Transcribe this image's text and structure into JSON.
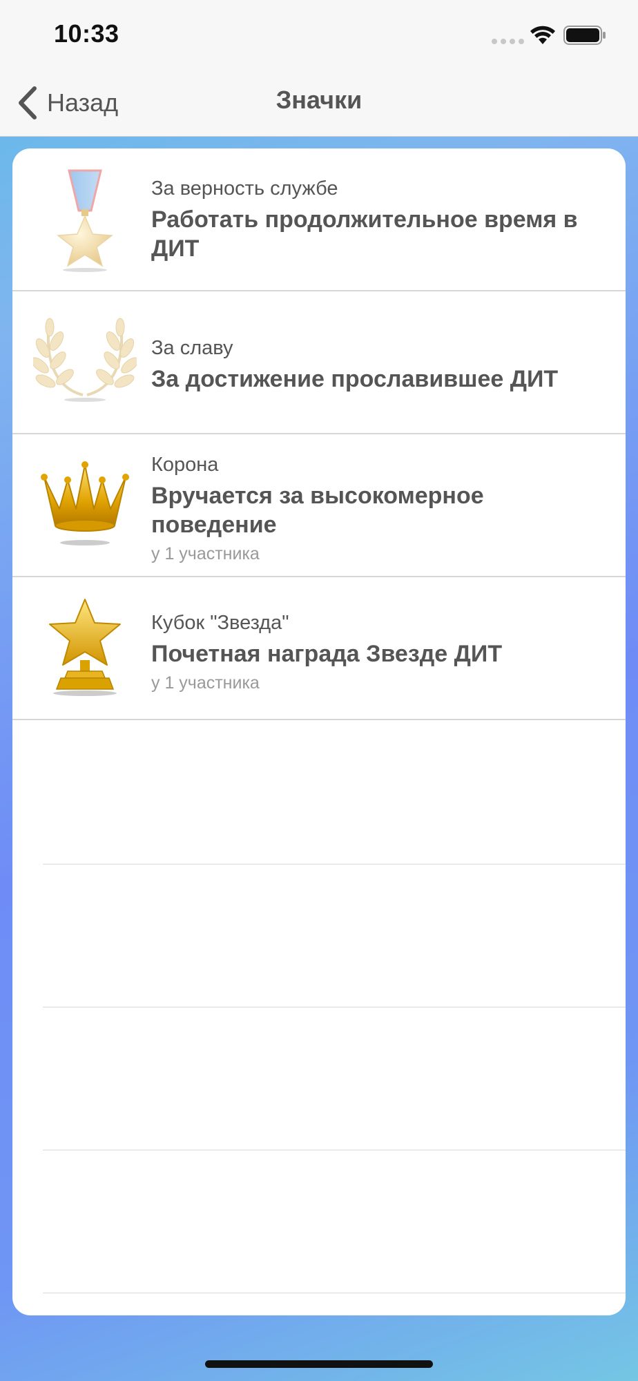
{
  "status_bar": {
    "time": "10:33"
  },
  "nav": {
    "back_label": "Назад",
    "title": "Значки"
  },
  "badges": [
    {
      "name": "За верность службе",
      "description": "Работать продолжительное время в ДИТ",
      "count": "",
      "icon": "medal-icon"
    },
    {
      "name": "За славу",
      "description": "За достижение прославившее ДИТ",
      "count": "",
      "icon": "laurel-wreath-icon"
    },
    {
      "name": "Корона",
      "description": "Вручается за высокомерное поведение",
      "count": "у 1 участника",
      "icon": "crown-icon"
    },
    {
      "name": "Кубок \"Звезда\"",
      "description": "Почетная награда Звезде ДИТ",
      "count": "у 1 участника",
      "icon": "star-trophy-icon"
    }
  ]
}
